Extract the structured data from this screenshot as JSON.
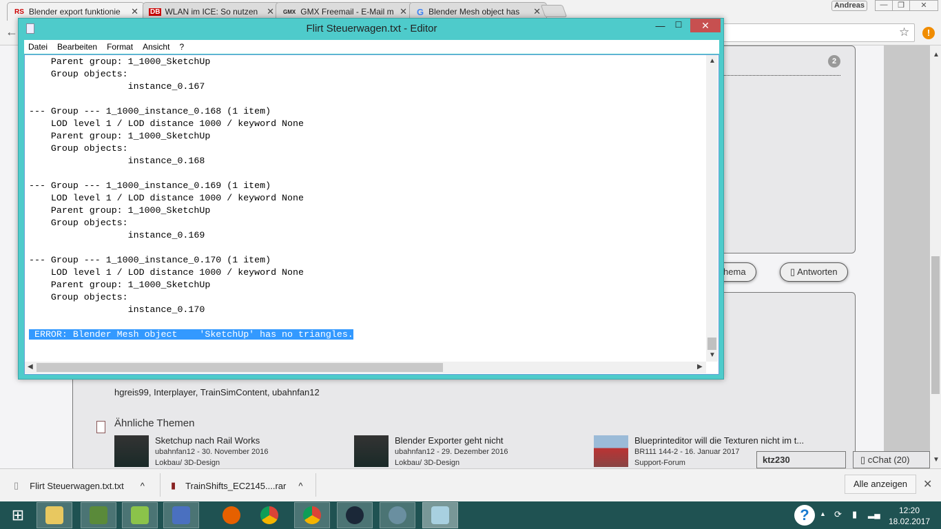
{
  "browser": {
    "tabs": [
      {
        "favicon": "RS",
        "title": "Blender export funktionie",
        "active": true
      },
      {
        "favicon": "DB",
        "title": "WLAN im ICE: So nutzen",
        "active": false
      },
      {
        "favicon": "GMX",
        "title": "GMX Freemail - E-Mail m",
        "active": false
      },
      {
        "favicon": "G",
        "title": "Blender Mesh object has",
        "active": false
      }
    ],
    "profile": "Andreas",
    "alert": "!"
  },
  "page": {
    "badge": "2",
    "new_topic_label": "es Thema",
    "reply_label": "Antworten",
    "users": "hgreis99, Interplayer, TrainSimContent, ubahnfan12",
    "similar_title": "Ähnliche Themen",
    "threads": [
      {
        "title": "Sketchup nach Rail Works",
        "meta": "ubahnfan12 - 30. November 2016",
        "forum": "Lokbau/ 3D-Design"
      },
      {
        "title": "Blender Exporter geht nicht",
        "meta": "ubahnfan12 - 29. Dezember 2016",
        "forum": "Lokbau/ 3D-Design"
      },
      {
        "title": "Blueprinteditor will die Texturen nicht im t...",
        "meta": "BR111 144-2 - 16. Januar 2017",
        "forum": "Support-Forum"
      }
    ],
    "chat_user": "ktz230",
    "chat_label": "cChat (20)"
  },
  "notepad": {
    "title": "Flirt Steuerwagen.txt - Editor",
    "menu": [
      "Datei",
      "Bearbeiten",
      "Format",
      "Ansicht",
      "?"
    ],
    "lines": [
      "    Parent group: 1_1000_SketchUp",
      "    Group objects:",
      "                  instance_0.167",
      "",
      "--- Group --- 1_1000_instance_0.168 (1 item)",
      "    LOD level 1 / LOD distance 1000 / keyword None",
      "    Parent group: 1_1000_SketchUp",
      "    Group objects:",
      "                  instance_0.168",
      "",
      "--- Group --- 1_1000_instance_0.169 (1 item)",
      "    LOD level 1 / LOD distance 1000 / keyword None",
      "    Parent group: 1_1000_SketchUp",
      "    Group objects:",
      "                  instance_0.169",
      "",
      "--- Group --- 1_1000_instance_0.170 (1 item)",
      "    LOD level 1 / LOD distance 1000 / keyword None",
      "    Parent group: 1_1000_SketchUp",
      "    Group objects:",
      "                  instance_0.170",
      ""
    ],
    "selected_line": " ERROR: Blender Mesh object    'SketchUp' has no triangles."
  },
  "downloads": {
    "items": [
      "Flirt Steuerwagen.txt.txt",
      "TrainShifts_EC2145....rar"
    ],
    "show_all": "Alle anzeigen"
  },
  "taskbar": {
    "time": "12:20",
    "date": "18.02.2017",
    "help": "?"
  }
}
